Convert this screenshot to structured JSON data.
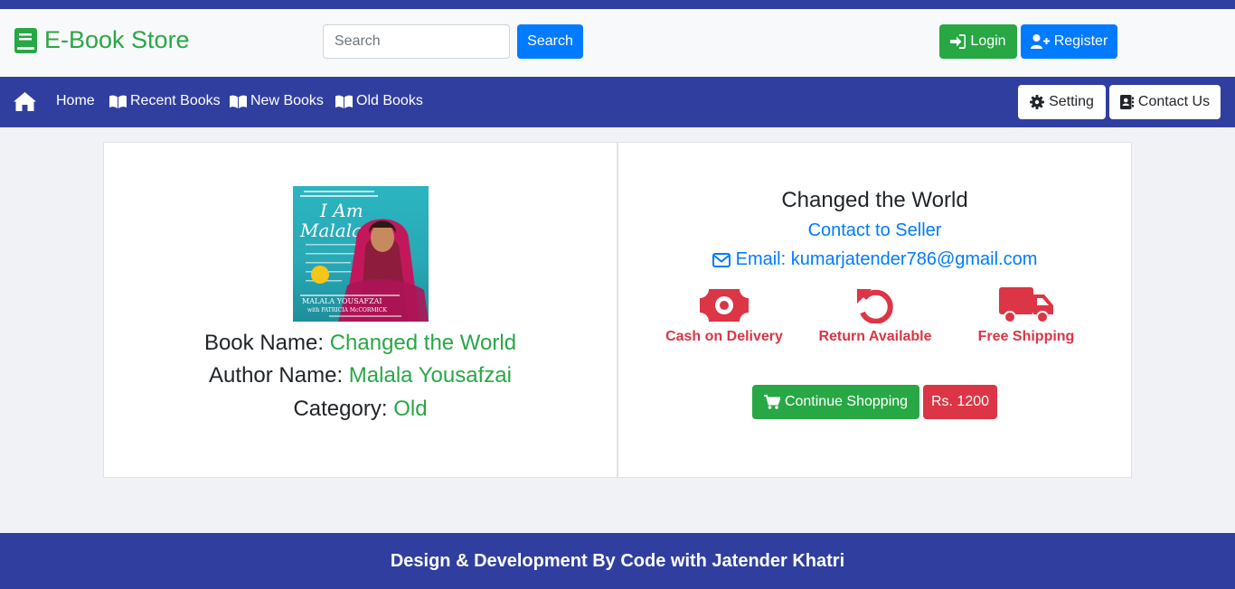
{
  "header": {
    "brand": "E-Book Store",
    "search_placeholder": "Search",
    "search_button": "Search",
    "login_label": "Login",
    "register_label": "Register"
  },
  "nav": {
    "home": "Home",
    "recent": "Recent Books",
    "new": "New Books",
    "old": "Old Books",
    "setting": "Setting",
    "contact": "Contact Us"
  },
  "book": {
    "name_label": "Book Name:",
    "name": "Changed the World",
    "author_label": "Author Name:",
    "author": "Malala Yousafzai",
    "category_label": "Category:",
    "category": "Old",
    "cover": {
      "title": "I Am Malala",
      "author_caption": "MALALA YOUSAFZAI",
      "coauthor_caption": "with PATRICIA McCORMICK"
    }
  },
  "detail": {
    "title": "Changed the World",
    "contact": "Contact to Seller",
    "email": "Email: kumarjatender786@gmail.com",
    "features": [
      "Cash on Delivery",
      "Return Available",
      "Free Shipping"
    ],
    "continue_label": "Continue Shopping",
    "price": "Rs. 1200"
  },
  "footer": {
    "text": "Design & Development By Code with Jatender Khatri"
  },
  "colors": {
    "primary_nav": "#303f9f",
    "green": "#28a745",
    "blue": "#007bff",
    "red": "#dc3545"
  }
}
